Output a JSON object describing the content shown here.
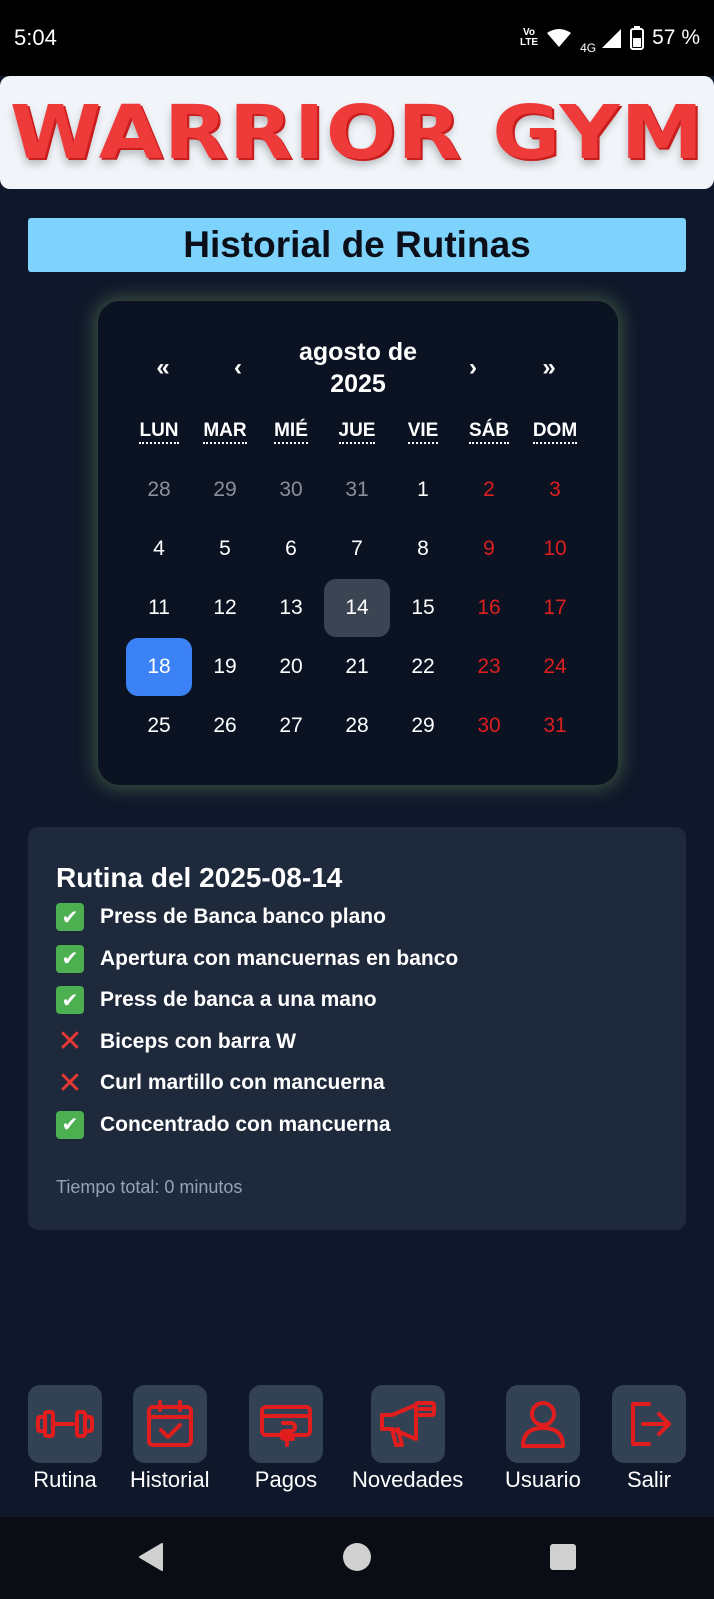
{
  "status_bar": {
    "time": "5:04",
    "volte_line1": "Vo",
    "volte_line2": "LTE",
    "network": "4G",
    "battery": "57 %"
  },
  "header": {
    "logo_text": "WARRIOR GYM"
  },
  "page_title": "Historial de Rutinas",
  "calendar": {
    "prev_year": "«",
    "prev_month": "‹",
    "month_label_line1": "agosto de",
    "month_label_line2": "2025",
    "next_month": "›",
    "next_year": "»",
    "weekdays": [
      "LUN",
      "MAR",
      "MIÉ",
      "JUE",
      "VIE",
      "SÁB",
      "DOM"
    ],
    "weeks": [
      [
        "28",
        "29",
        "30",
        "31",
        "1",
        "2",
        "3"
      ],
      [
        "4",
        "5",
        "6",
        "7",
        "8",
        "9",
        "10"
      ],
      [
        "11",
        "12",
        "13",
        "14",
        "15",
        "16",
        "17"
      ],
      [
        "18",
        "19",
        "20",
        "21",
        "22",
        "23",
        "24"
      ],
      [
        "25",
        "26",
        "27",
        "28",
        "29",
        "30",
        "31"
      ]
    ],
    "highlighted_day": "14",
    "selected_day": "18"
  },
  "routine": {
    "title": "Rutina del 2025-08-14",
    "exercises": [
      {
        "name": "Press de Banca banco plano",
        "done": true
      },
      {
        "name": "Apertura con mancuernas en banco",
        "done": true
      },
      {
        "name": "Press de banca a una mano",
        "done": true
      },
      {
        "name": "Biceps con barra W",
        "done": false
      },
      {
        "name": "Curl martillo con mancuerna",
        "done": false
      },
      {
        "name": "Concentrado con mancuerna",
        "done": true
      }
    ],
    "total_time": "Tiempo total: 0 minutos"
  },
  "bottom_nav": {
    "items": [
      {
        "label": "Rutina",
        "icon": "dumbbell-icon"
      },
      {
        "label": "Historial",
        "icon": "calendar-check-icon"
      },
      {
        "label": "Pagos",
        "icon": "payment-icon"
      },
      {
        "label": "Novedades",
        "icon": "megaphone-icon"
      },
      {
        "label": "Usuario",
        "icon": "user-icon"
      },
      {
        "label": "Salir",
        "icon": "logout-icon"
      }
    ]
  },
  "colors": {
    "background": "#0f172a",
    "accent_blue": "#3b82f6",
    "banner": "#7dd3fc",
    "brand_red": "#ef3a3a",
    "weekend_red": "#dc1f1f"
  }
}
